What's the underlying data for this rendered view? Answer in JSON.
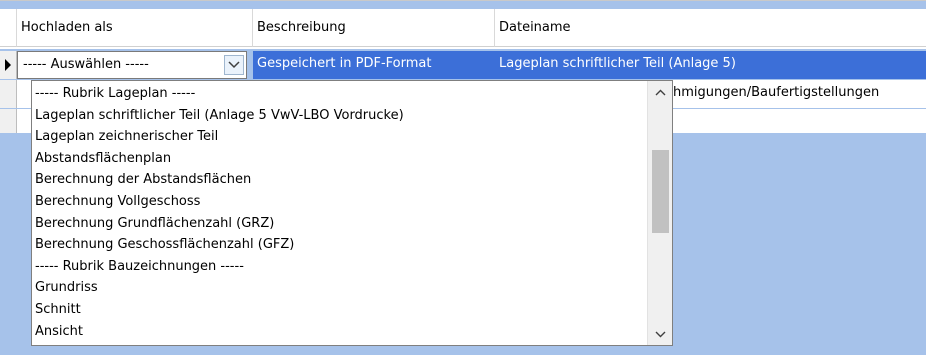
{
  "headers": [
    "Hochladen als",
    "Beschreibung",
    "Dateiname"
  ],
  "rows": [
    {
      "upload_as": "----- Auswählen -----",
      "description": "Gespeichert in PDF-Format",
      "filename": "Lageplan schriftlicher Teil (Anlage 5)"
    },
    {
      "filename_partial": "hmigungen/Baufertigstellungen"
    }
  ],
  "dropdown": {
    "options": [
      "----- Rubrik Lageplan -----",
      "Lageplan schriftlicher Teil (Anlage 5 VwV-LBO Vordrucke)",
      "Lageplan zeichnerischer Teil",
      "Abstandsflächenplan",
      "Berechnung der Abstandsflächen",
      "Berechnung Vollgeschoss",
      "Berechnung Grundflächenzahl (GRZ)",
      "Berechnung Geschossflächenzahl (GFZ)",
      "----- Rubrik Bauzeichnungen -----",
      "Grundriss",
      "Schnitt",
      "Ansicht"
    ]
  },
  "icons": {
    "row_indicator": "current-row-arrow-icon",
    "combo_button": "chevron-down-icon",
    "scroll_up": "chevron-up-icon",
    "scroll_down": "chevron-down-icon"
  },
  "colors": {
    "selection": "#3c6fd8",
    "grid_background": "#a6c2ea"
  }
}
